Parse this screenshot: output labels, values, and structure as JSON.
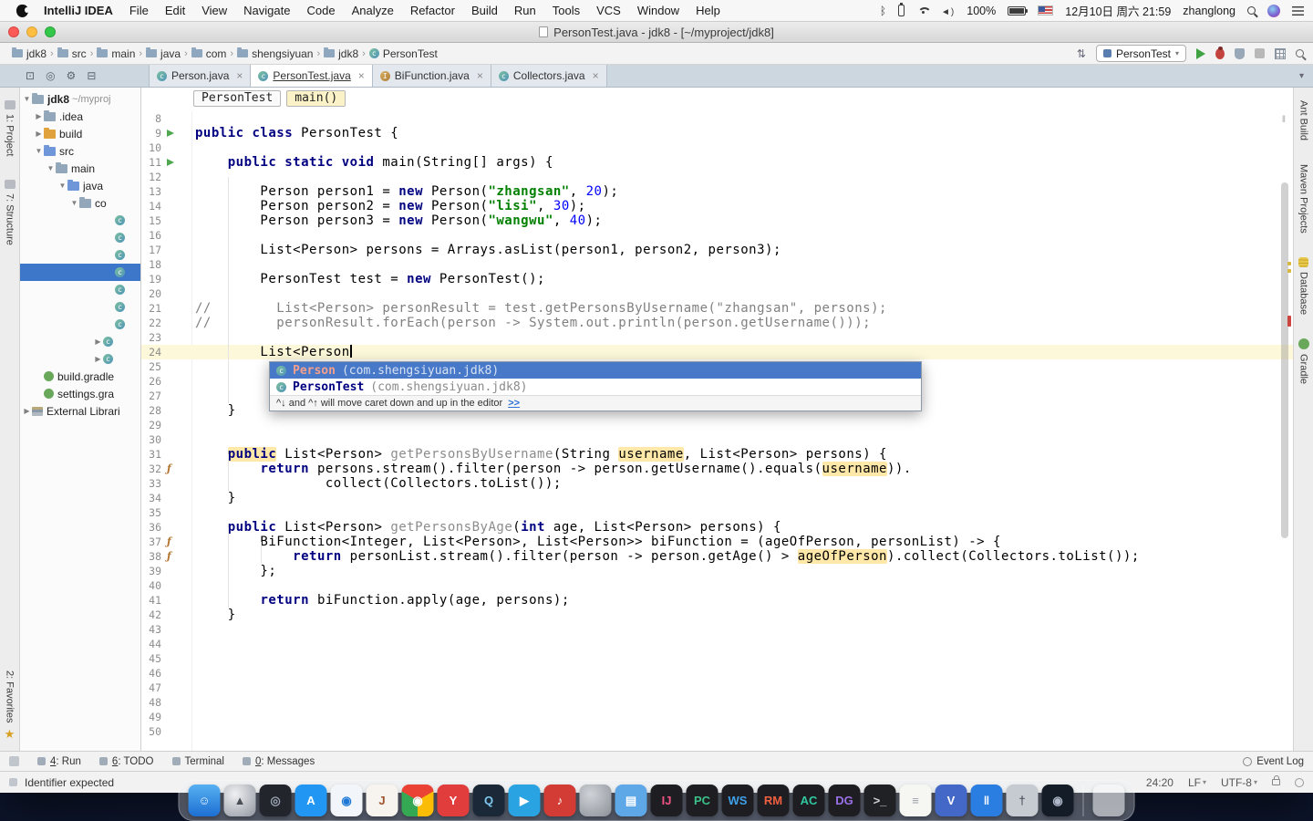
{
  "menubar": {
    "items": [
      "IntelliJ IDEA",
      "File",
      "Edit",
      "View",
      "Navigate",
      "Code",
      "Analyze",
      "Refactor",
      "Build",
      "Run",
      "Tools",
      "VCS",
      "Window",
      "Help"
    ],
    "status": [
      {
        "type": "bluetooth"
      },
      {
        "type": "battery-vertical"
      },
      {
        "type": "wifi"
      },
      {
        "type": "volume"
      },
      {
        "type": "text",
        "name": "battery-percent",
        "label": "100%"
      },
      {
        "type": "battery"
      },
      {
        "type": "flag"
      },
      {
        "type": "text",
        "name": "clock",
        "label": "12月10日 周六 21:59"
      },
      {
        "type": "text",
        "name": "user",
        "label": "zhanglong"
      },
      {
        "type": "search"
      },
      {
        "type": "siri"
      },
      {
        "type": "notification"
      }
    ]
  },
  "window": {
    "title": "PersonTest.java - jdk8 - [~/myproject/jdk8]"
  },
  "navbar": {
    "breadcrumbs": [
      {
        "label": "jdk8",
        "icon": "folder"
      },
      {
        "label": "src",
        "icon": "folder"
      },
      {
        "label": "main",
        "icon": "folder"
      },
      {
        "label": "java",
        "icon": "folder"
      },
      {
        "label": "com",
        "icon": "folder"
      },
      {
        "label": "shengsiyuan",
        "icon": "folder"
      },
      {
        "label": "jdk8",
        "icon": "folder"
      },
      {
        "label": "PersonTest",
        "icon": "class"
      }
    ],
    "run_config": "PersonTest"
  },
  "tabs": [
    {
      "label": "Person.java",
      "icon": "class",
      "active": false
    },
    {
      "label": "PersonTest.java",
      "icon": "class",
      "active": true
    },
    {
      "label": "BiFunction.java",
      "icon": "interface",
      "active": false
    },
    {
      "label": "Collectors.java",
      "icon": "class",
      "active": false
    }
  ],
  "panel_toolbar_icons": [
    "split-icon",
    "locate-icon",
    "gear-icon",
    "collapse-icon"
  ],
  "left_stripe": {
    "top": [
      "1: Project",
      "7: Structure"
    ],
    "bottom": [
      "2: Favorites"
    ]
  },
  "right_stripe": [
    {
      "label": "Ant Build"
    },
    {
      "label": "Maven Projects"
    },
    {
      "label": "Database",
      "icon": "database"
    },
    {
      "label": "Gradle",
      "icon": "gradle"
    }
  ],
  "project_tree": [
    {
      "ind": 0,
      "arrow": "v",
      "icon": "folder",
      "label": "jdk8",
      "sub": "~/myproj",
      "bold": true
    },
    {
      "ind": 1,
      "arrow": "c",
      "icon": "folder",
      "label": ".idea"
    },
    {
      "ind": 1,
      "arrow": "c",
      "icon": "folder-x",
      "label": "build"
    },
    {
      "ind": 1,
      "arrow": "v",
      "icon": "folder-s",
      "label": "src"
    },
    {
      "ind": 2,
      "arrow": "v",
      "icon": "folder",
      "label": "main"
    },
    {
      "ind": 3,
      "arrow": "v",
      "icon": "folder-s",
      "label": "java"
    },
    {
      "ind": 4,
      "arrow": "v",
      "icon": "folder",
      "label": "co"
    },
    {
      "ind": 7,
      "arrow": "",
      "icon": "class",
      "label": ""
    },
    {
      "ind": 7,
      "arrow": "",
      "icon": "class",
      "label": ""
    },
    {
      "ind": 7,
      "arrow": "",
      "icon": "class",
      "label": ""
    },
    {
      "ind": 7,
      "arrow": "",
      "icon": "class",
      "label": "",
      "sel": true
    },
    {
      "ind": 7,
      "arrow": "",
      "icon": "class",
      "label": ""
    },
    {
      "ind": 7,
      "arrow": "",
      "icon": "class",
      "label": ""
    },
    {
      "ind": 7,
      "arrow": "",
      "icon": "class",
      "label": ""
    },
    {
      "ind": 6,
      "arrow": "c",
      "icon": "class",
      "label": ""
    },
    {
      "ind": 6,
      "arrow": "c",
      "icon": "class",
      "label": ""
    },
    {
      "ind": 1,
      "arrow": "",
      "icon": "gradle",
      "label": "build.gradle"
    },
    {
      "ind": 1,
      "arrow": "",
      "icon": "gradle",
      "label": "settings.gra"
    },
    {
      "ind": 0,
      "arrow": "c",
      "icon": "lib",
      "label": "External Librari"
    }
  ],
  "editor": {
    "breadcrumbs": [
      "PersonTest",
      "main()"
    ],
    "first_line": 8,
    "caret_line": 24,
    "run_lines": [
      9,
      11
    ],
    "marker_lines": [
      32,
      37,
      38
    ],
    "lines": [
      [],
      [
        [
          "k",
          "public class "
        ],
        [
          "p",
          "PersonTest {"
        ]
      ],
      [],
      [
        [
          "p",
          "    "
        ],
        [
          "k",
          "public static void "
        ],
        [
          "p",
          "main(String[] args) {"
        ]
      ],
      [],
      [
        [
          "p",
          "        Person person1 = "
        ],
        [
          "k",
          "new "
        ],
        [
          "p",
          "Person("
        ],
        [
          "s",
          "\"zhangsan\""
        ],
        [
          "p",
          ", "
        ],
        [
          "n",
          "20"
        ],
        [
          "p",
          ");"
        ]
      ],
      [
        [
          "p",
          "        Person person2 = "
        ],
        [
          "k",
          "new "
        ],
        [
          "p",
          "Person("
        ],
        [
          "s",
          "\"lisi\""
        ],
        [
          "p",
          ", "
        ],
        [
          "n",
          "30"
        ],
        [
          "p",
          ");"
        ]
      ],
      [
        [
          "p",
          "        Person person3 = "
        ],
        [
          "k",
          "new "
        ],
        [
          "p",
          "Person("
        ],
        [
          "s",
          "\"wangwu\""
        ],
        [
          "p",
          ", "
        ],
        [
          "n",
          "40"
        ],
        [
          "p",
          ");"
        ]
      ],
      [],
      [
        [
          "p",
          "        List<Person> persons = Arrays.asList(person1, person2, person3);"
        ]
      ],
      [],
      [
        [
          "p",
          "        PersonTest test = "
        ],
        [
          "k",
          "new "
        ],
        [
          "p",
          "PersonTest();"
        ]
      ],
      [],
      [
        [
          "c",
          "//        List<Person> personResult = test.getPersonsByUsername(\"zhangsan\", persons);"
        ]
      ],
      [
        [
          "c",
          "//        personResult.forEach(person -> System.out.println(person.getUsername()));"
        ]
      ],
      [],
      [
        [
          "p",
          "        List<Person"
        ]
      ],
      [],
      [],
      [],
      [
        [
          "p",
          "    }"
        ]
      ],
      [],
      [],
      [
        [
          "p",
          "    "
        ],
        [
          "khl",
          "public"
        ],
        [
          "p",
          " List<Person> "
        ],
        [
          "m",
          "getPersonsByUsername"
        ],
        [
          "p",
          "(String "
        ],
        [
          "hl",
          "username"
        ],
        [
          "p",
          ", List<Person> persons) {"
        ]
      ],
      [
        [
          "p",
          "        "
        ],
        [
          "k",
          "return "
        ],
        [
          "p",
          "persons.stream().filter(person -> person.getUsername().equals("
        ],
        [
          "hl",
          "username"
        ],
        [
          "p",
          "))."
        ]
      ],
      [
        [
          "p",
          "                collect(Collectors.toList());"
        ]
      ],
      [
        [
          "p",
          "    }"
        ]
      ],
      [],
      [
        [
          "p",
          "    "
        ],
        [
          "k",
          "public "
        ],
        [
          "p",
          "List<Person> "
        ],
        [
          "m",
          "getPersonsByAge"
        ],
        [
          "p",
          "("
        ],
        [
          "k",
          "int "
        ],
        [
          "p",
          "age, List<Person> persons) {"
        ]
      ],
      [
        [
          "p",
          "        BiFunction<Integer, List<Person>, List<Person>> biFunction = (ageOfPerson, personList) -> {"
        ]
      ],
      [
        [
          "p",
          "            "
        ],
        [
          "k",
          "return "
        ],
        [
          "p",
          "personList.stream().filter(person -> person.getAge() > "
        ],
        [
          "hl",
          "ageOfPerson"
        ],
        [
          "p",
          ").collect(Collectors.toList());"
        ]
      ],
      [
        [
          "p",
          "        };"
        ]
      ],
      [],
      [
        [
          "p",
          "        "
        ],
        [
          "k",
          "return "
        ],
        [
          "p",
          "biFunction.apply(age, persons);"
        ]
      ],
      [
        [
          "p",
          "    }"
        ]
      ],
      [],
      [],
      [],
      [],
      [],
      [],
      [],
      []
    ]
  },
  "popup": {
    "items": [
      {
        "name": "Person",
        "pkg": "(com.shengsiyuan.jdk8)",
        "selected": true
      },
      {
        "name": "PersonTest",
        "pkg": "(com.shengsiyuan.jdk8)",
        "selected": false
      }
    ],
    "hint": "^↓ and ^↑ will move caret down and up in the editor",
    "hint_link": ">>"
  },
  "bottom_bar": {
    "left": [
      {
        "label": "4: Run"
      },
      {
        "label": "6: TODO"
      },
      {
        "label": "Terminal"
      },
      {
        "label": "0: Messages"
      }
    ],
    "right": [
      {
        "label": "Event Log"
      }
    ]
  },
  "statusbar": {
    "message": "Identifier expected",
    "caret": "24:20",
    "line_ending": "LF",
    "encoding": "UTF-8"
  },
  "colors": {
    "accent_selection": "#3c77c9",
    "keyword": "#000080",
    "string": "#008000",
    "number": "#0000ff",
    "comment": "#808080",
    "occurrence_highlight": "#ffe8a8",
    "caret_row": "#fdf8da",
    "run_green": "#3fa344",
    "error_red": "#cc4540"
  },
  "dock": [
    {
      "name": "finder",
      "bg": "linear-gradient(180deg,#57b0f2,#1d6fd2)",
      "glyph": "☺",
      "fg": "#eaf4ff"
    },
    {
      "name": "launchpad",
      "bg": "radial-gradient(circle at 35% 30%,#f0f0f2,#9096a0)",
      "glyph": "▲",
      "fg": "#4a4e56"
    },
    {
      "name": "dark-browser",
      "bg": "#23252d",
      "glyph": "◎",
      "fg": "#9aa4b2"
    },
    {
      "name": "app-store",
      "bg": "#2196f3",
      "glyph": "A",
      "fg": "#ffffff"
    },
    {
      "name": "safari",
      "bg": "#f2f6fa",
      "glyph": "◉",
      "fg": "#1e78d6"
    },
    {
      "name": "java",
      "bg": "#f7f4ef",
      "glyph": "J",
      "fg": "#a0522d"
    },
    {
      "name": "chrome",
      "bg": "conic-gradient(from -60deg,#ea4335 0 120deg,#fbbc05 120deg 240deg,#34a853 240deg 360deg)",
      "glyph": "◉",
      "fg": "#ffffff"
    },
    {
      "name": "youdao",
      "bg": "#e23d3d",
      "glyph": "Y",
      "fg": "#ffffff"
    },
    {
      "name": "qq",
      "bg": "#1b2838",
      "glyph": "Q",
      "fg": "#7ec8f0"
    },
    {
      "name": "telegram",
      "bg": "#29a3e2",
      "glyph": "▶",
      "fg": "#ffffff"
    },
    {
      "name": "music",
      "bg": "#d23c35",
      "glyph": "♪",
      "fg": "#ffffff"
    },
    {
      "name": "gray-ball",
      "bg": "radial-gradient(circle at 35% 30%,#cfd3d8,#8b9097)",
      "glyph": "",
      "fg": "#ffffff"
    },
    {
      "name": "blue-doc",
      "bg": "#5fa8e8",
      "glyph": "▤",
      "fg": "#ffffff"
    },
    {
      "name": "intellij",
      "bg": "#1e1e22",
      "glyph": "IJ",
      "fg": "#f05383"
    },
    {
      "name": "pycharm",
      "bg": "#1e1e22",
      "glyph": "PC",
      "fg": "#3cc089"
    },
    {
      "name": "webstorm",
      "bg": "#1e1e22",
      "glyph": "WS",
      "fg": "#3fa0e8"
    },
    {
      "name": "rubymine",
      "bg": "#1e1e22",
      "glyph": "RM",
      "fg": "#f06040"
    },
    {
      "name": "appcode",
      "bg": "#1e1e22",
      "glyph": "AC",
      "fg": "#30c8a0"
    },
    {
      "name": "datagrip",
      "bg": "#1e1e22",
      "glyph": "DG",
      "fg": "#9a70e8"
    },
    {
      "name": "terminal",
      "bg": "#202124",
      "glyph": ">_",
      "fg": "#d0d4d8"
    },
    {
      "name": "textedit",
      "bg": "#f6f6f3",
      "glyph": "≡",
      "fg": "#9aa0a8"
    },
    {
      "name": "visual-studio",
      "bg": "#4468c8",
      "glyph": "V",
      "fg": "#ffffff"
    },
    {
      "name": "parallels",
      "bg": "#2a7de1",
      "glyph": "‖",
      "fg": "#ffffff"
    },
    {
      "name": "utility",
      "bg": "#c6cbd2",
      "glyph": "†",
      "fg": "#555b64"
    },
    {
      "name": "steam",
      "bg": "#141c28",
      "glyph": "◉",
      "fg": "#aeb8c8"
    },
    {
      "name": "separator"
    },
    {
      "name": "trash",
      "bg": "rgba(245,247,250,0.55)",
      "glyph": "",
      "fg": "#888888"
    }
  ]
}
